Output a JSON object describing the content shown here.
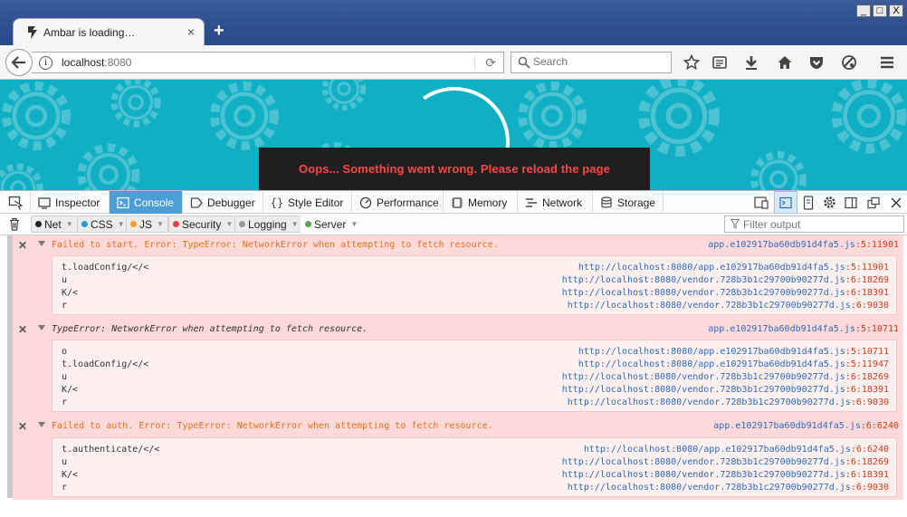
{
  "window": {
    "tab_title": "Ambar is loading…",
    "new_tab": "+",
    "controls": [
      "_",
      "□",
      "X"
    ]
  },
  "navbar": {
    "url_host": "localhost",
    "url_port": ":8080",
    "search_placeholder": "Search"
  },
  "page": {
    "toast": "Oops... Something went wrong. Please reload the page"
  },
  "devtools": {
    "tabs": [
      "Inspector",
      "Console",
      "Debugger",
      "Style Editor",
      "Performance",
      "Memory",
      "Network",
      "Storage"
    ],
    "active_tab": "Console",
    "filters": [
      "Net",
      "CSS",
      "JS",
      "Security",
      "Logging",
      "Server"
    ],
    "filter_colors": [
      "#222222",
      "#1e9fd8",
      "#f0a12a",
      "#e0413c",
      "#999999",
      "#5aa34e"
    ],
    "filter_placeholder": "Filter output"
  },
  "console": {
    "messages": [
      {
        "text": "Failed to start. Error: TypeError: NetworkError when attempting to fetch resource.",
        "file": "app.e102917ba60db91d4fa5.js",
        "line": ":5:11901",
        "frames": [
          {
            "fn": "t.loadConfig/</<",
            "url": "http://localhost:8080/app.e102917ba60db91d4fa5.js",
            "line": ":5:11901"
          },
          {
            "fn": "u",
            "url": "http://localhost:8080/vendor.728b3b1c29700b90277d.js",
            "line": ":6:18269"
          },
          {
            "fn": "K/<",
            "url": "http://localhost:8080/vendor.728b3b1c29700b90277d.js",
            "line": ":6:18391"
          },
          {
            "fn": "r",
            "url": "http://localhost:8080/vendor.728b3b1c29700b90277d.js",
            "line": ":6:9030"
          }
        ]
      },
      {
        "text": "TypeError: NetworkError when attempting to fetch resource.",
        "file": "app.e102917ba60db91d4fa5.js",
        "line": ":5:10711",
        "frames": [
          {
            "fn": "o",
            "url": "http://localhost:8080/app.e102917ba60db91d4fa5.js",
            "line": ":5:10711"
          },
          {
            "fn": "t.loadConfig/</<",
            "url": "http://localhost:8080/app.e102917ba60db91d4fa5.js",
            "line": ":5:11947"
          },
          {
            "fn": "u",
            "url": "http://localhost:8080/vendor.728b3b1c29700b90277d.js",
            "line": ":6:18269"
          },
          {
            "fn": "K/<",
            "url": "http://localhost:8080/vendor.728b3b1c29700b90277d.js",
            "line": ":6:18391"
          },
          {
            "fn": "r",
            "url": "http://localhost:8080/vendor.728b3b1c29700b90277d.js",
            "line": ":6:9030"
          }
        ]
      },
      {
        "text": "Failed to auth. Error: TypeError: NetworkError when attempting to fetch resource.",
        "file": "app.e102917ba60db91d4fa5.js",
        "line": ":6:6240",
        "frames": [
          {
            "fn": "t.authenticate/</<",
            "url": "http://localhost:8080/app.e102917ba60db91d4fa5.js",
            "line": ":6:6240"
          },
          {
            "fn": "u",
            "url": "http://localhost:8080/vendor.728b3b1c29700b90277d.js",
            "line": ":6:18269"
          },
          {
            "fn": "K/<",
            "url": "http://localhost:8080/vendor.728b3b1c29700b90277d.js",
            "line": ":6:18391"
          },
          {
            "fn": "r",
            "url": "http://localhost:8080/vendor.728b3b1c29700b90277d.js",
            "line": ":6:9030"
          }
        ]
      }
    ]
  }
}
